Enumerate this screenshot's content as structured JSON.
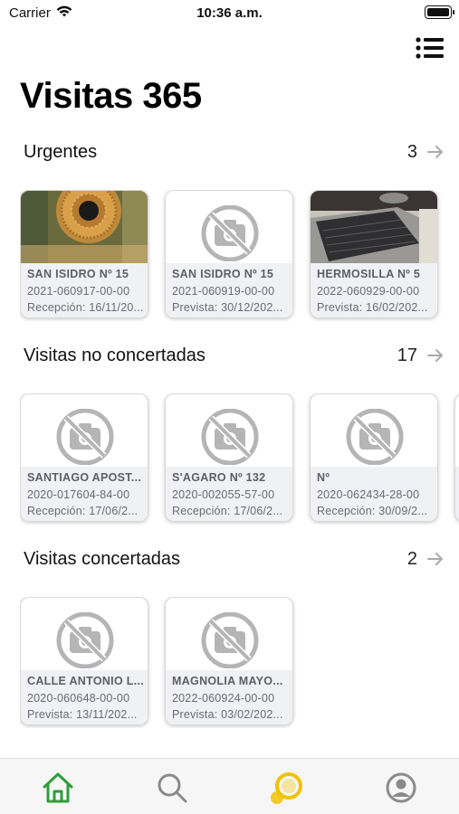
{
  "status_bar": {
    "carrier": "Carrier",
    "time": "10:36 a.m."
  },
  "header": {
    "title": "Visitas 365",
    "menu_icon": "list-menu-icon"
  },
  "sections": [
    {
      "title": "Urgentes",
      "count": "3",
      "cards": [
        {
          "name": "SAN ISIDRO Nº 15",
          "ref": "2021-060917-00-00",
          "date": "Recepción: 16/11/20...",
          "thumb": "photo-decoration"
        },
        {
          "name": "SAN ISIDRO Nº 15",
          "ref": "2021-060919-00-00",
          "date": "Prevista: 30/12/202...",
          "thumb": "no-photo-icon"
        },
        {
          "name": "HERMOSILLA Nº 5",
          "ref": "2022-060929-00-00",
          "date": "Prevista: 16/02/202...",
          "thumb": "photo-laptop"
        }
      ]
    },
    {
      "title": "Visitas no concertadas",
      "count": "17",
      "cards": [
        {
          "name": "SANTIAGO APOST...",
          "ref": "2020-017604-84-00",
          "date": "Recepción: 17/06/2...",
          "thumb": "no-photo-icon"
        },
        {
          "name": "S'AGARO Nº 132",
          "ref": "2020-002055-57-00",
          "date": "Recepción: 17/06/2...",
          "thumb": "no-photo-icon"
        },
        {
          "name": "Nº",
          "ref": "2020-062434-28-00",
          "date": "Recepción: 30/09/2...",
          "thumb": "no-photo-icon"
        },
        {
          "name": "",
          "ref": "",
          "date": "",
          "thumb": "no-photo-icon"
        }
      ]
    },
    {
      "title": "Visitas concertadas",
      "count": "2",
      "cards": [
        {
          "name": "CALLE ANTONIO L...",
          "ref": "2020-060648-00-00",
          "date": "Prevista: 13/11/202...",
          "thumb": "no-photo-icon"
        },
        {
          "name": "MAGNOLIA MAYO...",
          "ref": "2022-060924-00-00",
          "date": "Prevista: 03/02/202...",
          "thumb": "no-photo-icon"
        }
      ]
    }
  ],
  "tab_bar": {
    "tabs": [
      {
        "icon": "home-icon",
        "active": true
      },
      {
        "icon": "search-icon",
        "active": false
      },
      {
        "icon": "sync-circle-icon",
        "active": false
      },
      {
        "icon": "profile-icon",
        "active": false
      }
    ]
  },
  "colors": {
    "accent_green": "#2e9e3a",
    "accent_yellow": "#f2c200",
    "icon_gray": "#8a8a8a"
  }
}
